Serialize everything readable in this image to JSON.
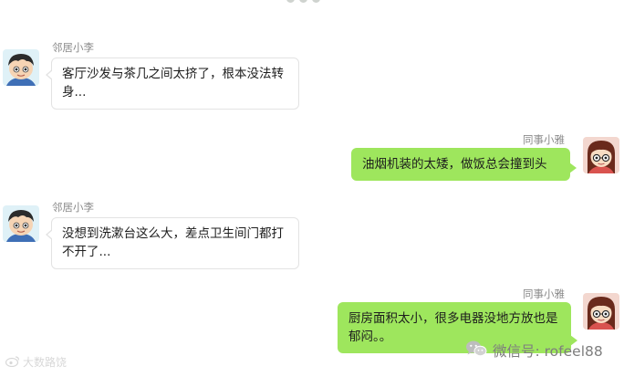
{
  "messages": [
    {
      "side": "left",
      "sender": "邻居小李",
      "text": "客厅沙发与茶几之间太挤了，根本没法转身..."
    },
    {
      "side": "right",
      "sender": "同事小雅",
      "text": "油烟机装的太矮，做饭总会撞到头"
    },
    {
      "side": "left",
      "sender": "邻居小李",
      "text": "没想到洗漱台这么大，差点卫生间门都打不开了..."
    },
    {
      "side": "right",
      "sender": "同事小雅",
      "text": "厨房面积太小，很多电器没地方放也是郁闷。。"
    }
  ],
  "watermarks": {
    "left": "大数路饶",
    "right": "微信号: rofeel88"
  },
  "colors": {
    "bubble_right": "#9ee65d",
    "bubble_left_border": "#e3e3e3",
    "sender_text": "#8a8a8a"
  },
  "icons": [
    "male-avatar-icon",
    "female-avatar-icon",
    "wechat-logo-icon",
    "weibo-logo-icon"
  ]
}
